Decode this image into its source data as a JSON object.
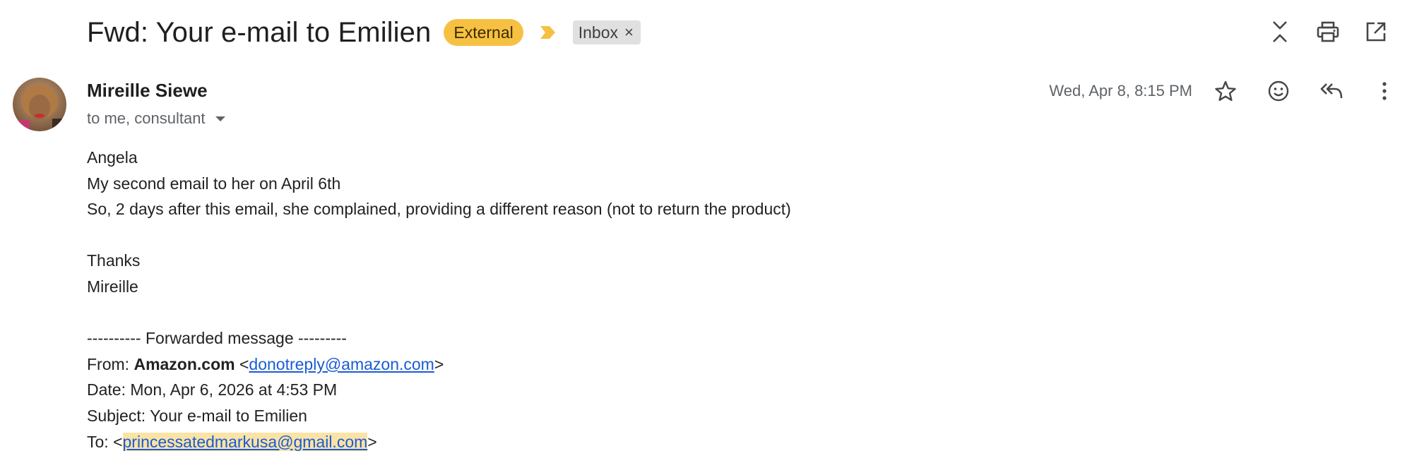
{
  "thread": {
    "subject": "Fwd: Your e-mail to Emilien",
    "labels": {
      "external": "External",
      "inbox": "Inbox",
      "inbox_remove": "×"
    },
    "colors": {
      "external_bg": "#f6c142",
      "important_marker": "#f6c142",
      "inbox_bg": "#e0e0e0"
    }
  },
  "header_actions": {
    "icons": [
      "collapse-all-icon",
      "print-icon",
      "open-in-new-window-icon"
    ]
  },
  "message": {
    "sender_name": "Mireille Siewe",
    "recipients": "to me, consultant",
    "date": "Wed, Apr 8, 8:15 PM",
    "action_icons": [
      "star-icon",
      "emoji-reaction-icon",
      "reply-all-icon",
      "more-vert-icon"
    ]
  },
  "body": {
    "greeting": "Angela",
    "line1": "My second email to her on April 6th",
    "line2": "So, 2 days after this email, she complained, providing a different reason (not to return the product)",
    "thanks": "Thanks",
    "signature": "Mireille",
    "forwarded_header": "---------- Forwarded message ---------",
    "from_label": "From: ",
    "from_name": "Amazon.com",
    "from_open": " <",
    "from_email": "donotreply@amazon.com",
    "from_close": ">",
    "date_line": "Date: Mon, Apr 6, 2026 at 4:53 PM",
    "subject_line": "Subject: Your e-mail to Emilien",
    "to_label": "To: <",
    "to_email": "princessatedmarkusa@gmail.com",
    "to_close": ">"
  }
}
